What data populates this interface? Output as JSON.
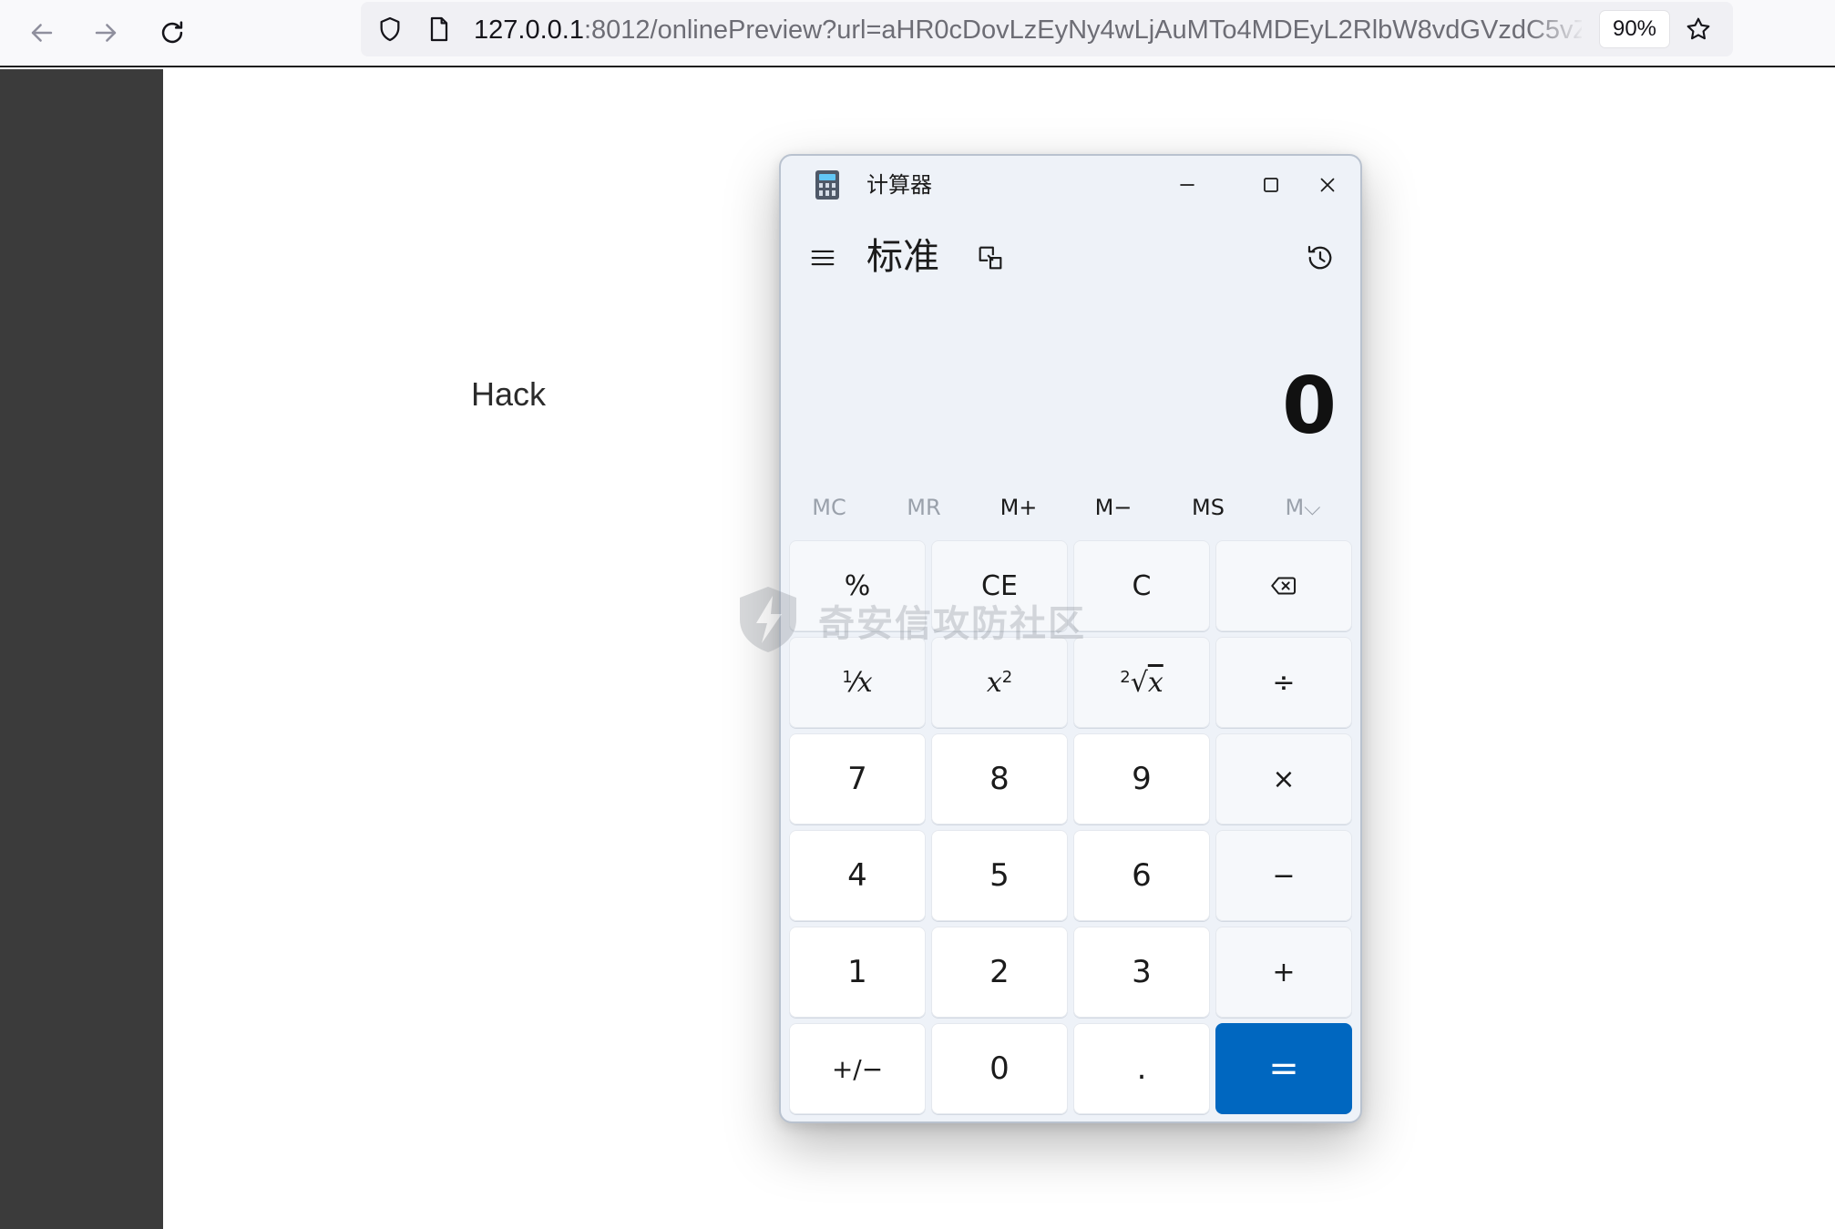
{
  "browser": {
    "url_host": "127.0.0.1",
    "url_path": ":8012/onlinePreview?url=aHR0cDovLzEyNy4wLjAuMTo4MDEyL2RlbW8vdGVzdC5vZ",
    "zoom": "90%",
    "icons": [
      "back-arrow-icon",
      "forward-arrow-icon",
      "reload-icon",
      "shield-icon",
      "page-icon",
      "star-icon"
    ]
  },
  "page": {
    "text": "Hack"
  },
  "calculator": {
    "window_title": "计算器",
    "mode": "标准",
    "display": "0",
    "memory": [
      {
        "label": "MC",
        "enabled": false
      },
      {
        "label": "MR",
        "enabled": false
      },
      {
        "label": "M+",
        "enabled": true
      },
      {
        "label": "M−",
        "enabled": true
      },
      {
        "label": "MS",
        "enabled": true
      },
      {
        "label": "M⌵",
        "enabled": false
      }
    ],
    "keys": {
      "percent": "%",
      "ce": "CE",
      "c": "C",
      "reciprocal_num": "1",
      "reciprocal_var": "x",
      "square_var": "x",
      "square_exp": "2",
      "root_index": "2",
      "root_var": "x",
      "divide": "÷",
      "seven": "7",
      "eight": "8",
      "nine": "9",
      "multiply": "×",
      "four": "4",
      "five": "5",
      "six": "6",
      "minus": "−",
      "one": "1",
      "two": "2",
      "three": "3",
      "plus": "+",
      "negate": "+/−",
      "zero": "0",
      "decimal": ".",
      "equals": "="
    },
    "accent_color": "#0067c0"
  },
  "watermark": {
    "text": "奇安信攻防社区"
  }
}
